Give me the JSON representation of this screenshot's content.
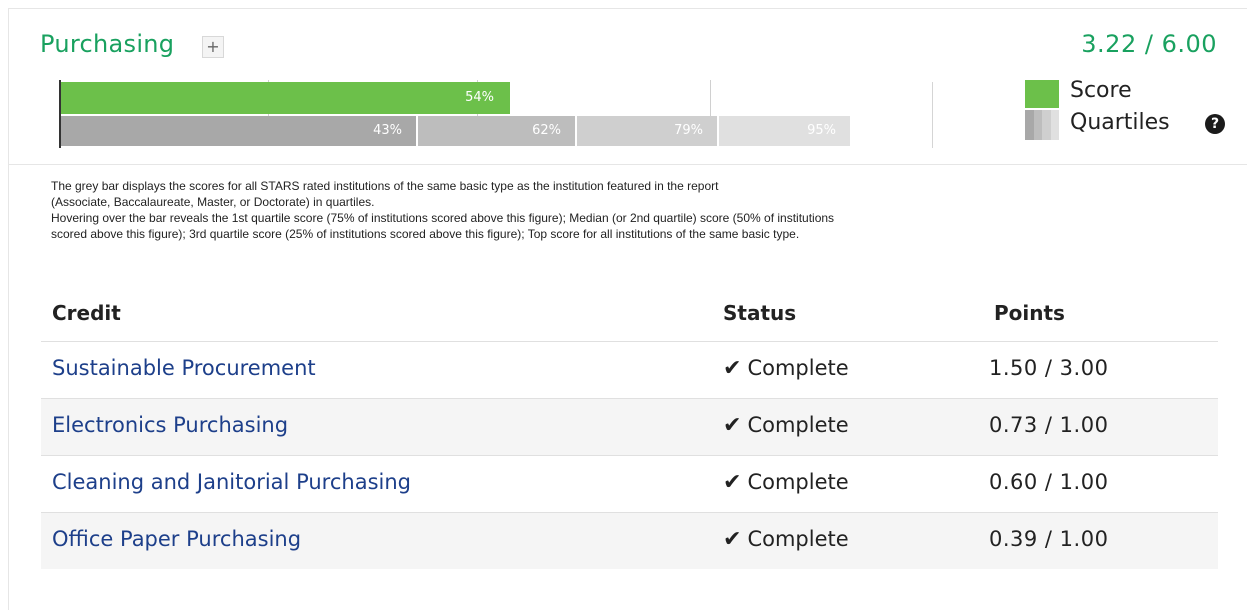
{
  "section": {
    "title": "Purchasing",
    "expand_label": "+",
    "score_total": "3.22 / 6.00"
  },
  "colors": {
    "accent_green": "#19a15f",
    "score_bar": "#6cc04a",
    "link_blue": "#1d3f8a",
    "quartile_1": "#a8a8a8",
    "quartile_2": "#bdbdbd",
    "quartile_3": "#cfcfcf",
    "quartile_4": "#e0e0e0"
  },
  "chart_data": {
    "type": "bar",
    "score_percent": 54,
    "score_label": "54%",
    "quartiles": [
      {
        "percent": 43,
        "label": "43%"
      },
      {
        "percent": 62,
        "label": "62%"
      },
      {
        "percent": 79,
        "label": "79%"
      },
      {
        "percent": 95,
        "label": "95%"
      }
    ],
    "xlim": [
      0,
      100
    ]
  },
  "legend": {
    "score_label": "Score",
    "quartiles_label": "Quartiles",
    "help_icon": "question-circle-icon"
  },
  "description": {
    "lines": [
      "The grey bar displays the scores for all STARS rated institutions of the same basic type as the institution featured in the report",
      "(Associate, Baccalaureate, Master, or Doctorate) in quartiles.",
      "Hovering over the bar reveals the 1st quartile score (75% of institutions scored above this figure); Median (or 2nd quartile) score (50% of institutions",
      "scored above this figure); 3rd quartile score (25% of institutions scored above this figure); Top score for all institutions of the same basic type."
    ]
  },
  "table": {
    "headers": {
      "credit": "Credit",
      "status": "Status",
      "points": "Points"
    },
    "rows": [
      {
        "credit": "Sustainable Procurement",
        "status": "Complete",
        "points": "1.50 / 3.00"
      },
      {
        "credit": "Electronics Purchasing",
        "status": "Complete",
        "points": "0.73 / 1.00"
      },
      {
        "credit": "Cleaning and Janitorial Purchasing",
        "status": "Complete",
        "points": "0.60 / 1.00"
      },
      {
        "credit": "Office Paper Purchasing",
        "status": "Complete",
        "points": "0.39 / 1.00"
      }
    ],
    "status_icon": "checkmark-icon"
  }
}
